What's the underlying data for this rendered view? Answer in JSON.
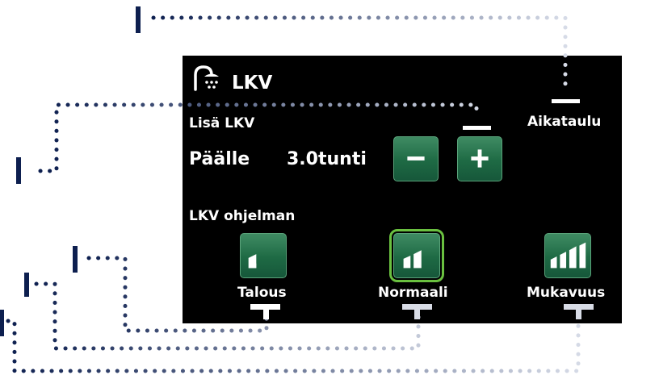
{
  "header": {
    "title": "LKV",
    "icon": "shower-icon"
  },
  "extra_hot_water": {
    "label": "Lisä LKV",
    "state": "Päälle",
    "duration": "3.0tunti",
    "minus_icon": "minus-icon",
    "plus_icon": "plus-icon"
  },
  "schedule": {
    "label": "Aikataulu"
  },
  "program": {
    "label": "LKV ohjelman",
    "selected": "Normaali",
    "modes": [
      {
        "label": "Talous",
        "icon": "signal-1-bar-icon"
      },
      {
        "label": "Normaali",
        "icon": "signal-2-bars-icon"
      },
      {
        "label": "Mukavuus",
        "icon": "signal-3-bars-icon"
      }
    ]
  },
  "colors": {
    "screen_bg": "#000000",
    "button_green": "#1e6a44",
    "selection_outline": "#6ac040",
    "callout_dark": "#0d1f4f",
    "callout_light": "#d6dbe7"
  }
}
